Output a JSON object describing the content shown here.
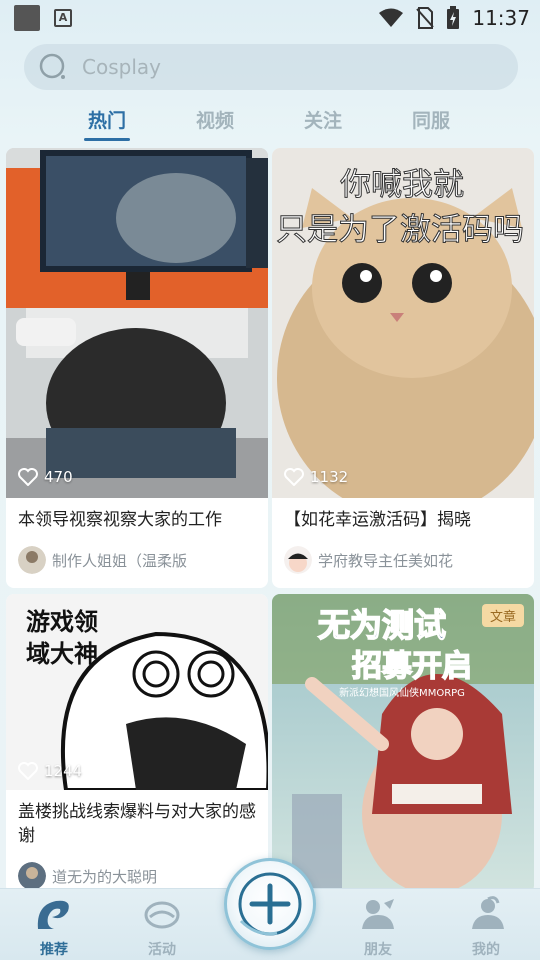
{
  "status_bar": {
    "time": "11:37"
  },
  "search": {
    "placeholder": "Cosplay"
  },
  "tabs": [
    {
      "label": "热门",
      "active": true
    },
    {
      "label": "视频",
      "active": false
    },
    {
      "label": "关注",
      "active": false
    },
    {
      "label": "同服",
      "active": false
    }
  ],
  "feed": [
    {
      "likes": "470",
      "title": "本领导视察视察大家的工作",
      "author": "制作人姐姐（温柔版"
    },
    {
      "likes": "1132",
      "image_caption": "你喊我就\n只是为了激活码吗",
      "title": "【如花幸运激活码】揭晓",
      "author": "学府教导主任美如花"
    },
    {
      "likes": "1244",
      "image_caption": "游戏领\n域大神",
      "title": "盖楼挑战线索爆料与对大家的感谢",
      "author": "道无为的大聪明"
    },
    {
      "badge": "文章",
      "image_caption_1": "无为测试",
      "image_caption_2": "招募开启",
      "image_caption_3": "新派幻想国风仙侠MMORPG"
    }
  ],
  "bottom_nav": [
    {
      "label": "推荐",
      "icon": "recommend-icon",
      "active": true
    },
    {
      "label": "活动",
      "icon": "activity-icon",
      "active": false
    },
    {
      "label": "",
      "icon": "plus-icon",
      "active": false
    },
    {
      "label": "朋友",
      "icon": "friends-icon",
      "active": false
    },
    {
      "label": "我的",
      "icon": "profile-icon",
      "active": false
    }
  ],
  "colors": {
    "accent": "#2d6fa5",
    "inactive_tab": "#a3b4bc",
    "badge_bg": "#f5d9a3"
  }
}
